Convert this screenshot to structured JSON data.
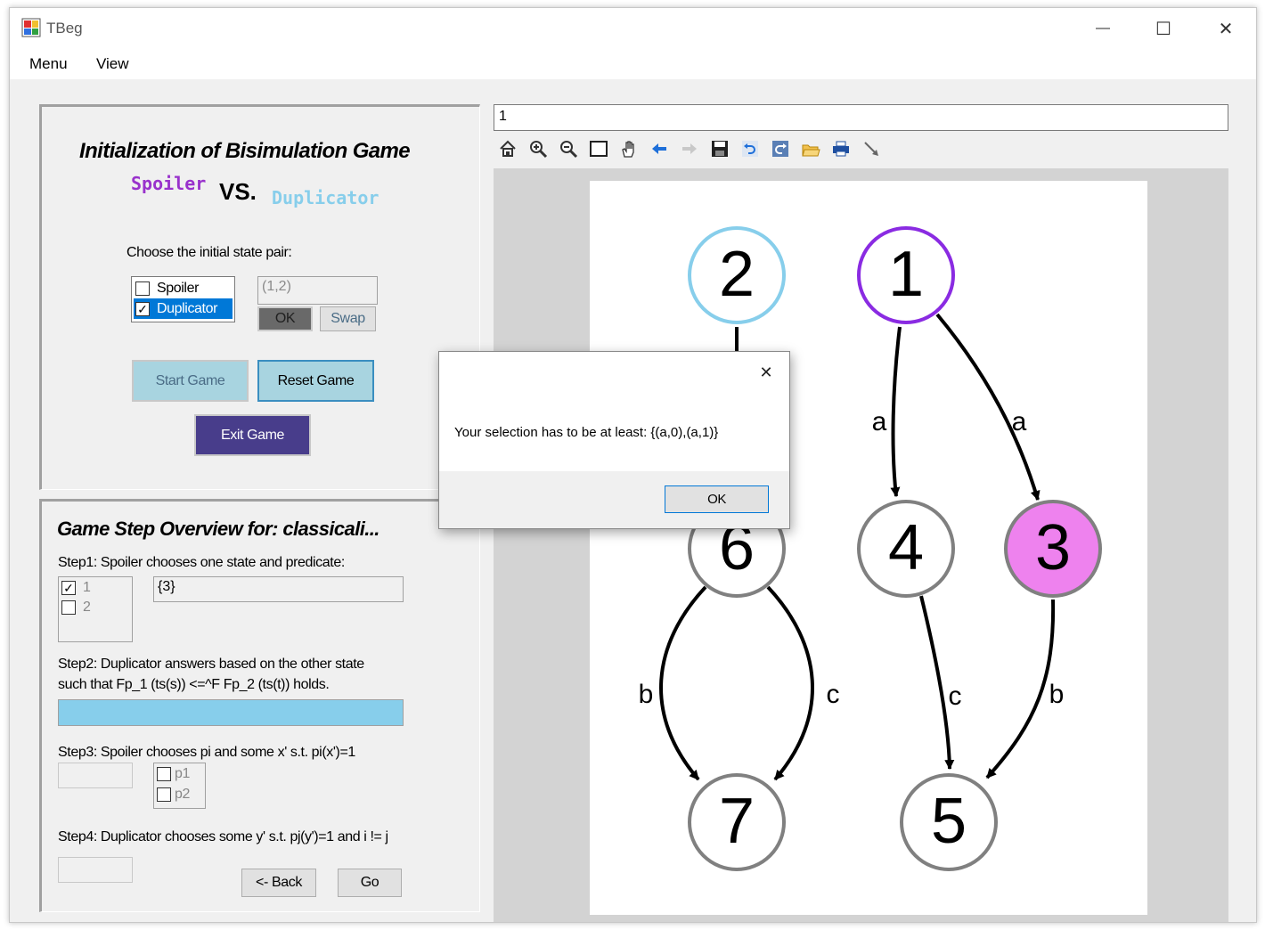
{
  "window": {
    "title": "TBeg",
    "minimize": "—",
    "maximize": "☐",
    "close": "✕"
  },
  "menu": {
    "items": [
      "Menu",
      "View"
    ]
  },
  "init_panel": {
    "title": "Initialization of Bisimulation Game",
    "spoiler": "Spoiler",
    "vs": "VS.",
    "duplicator": "Duplicator",
    "choose_label": "Choose the initial state pair:",
    "roles": [
      {
        "label": "Spoiler",
        "checked": false
      },
      {
        "label": "Duplicator",
        "checked": true
      }
    ],
    "pair_value": "(1,2)",
    "ok_label": "OK",
    "swap_label": "Swap",
    "start_label": "Start Game",
    "reset_label": "Reset Game",
    "exit_label": "Exit Game"
  },
  "steps_panel": {
    "title": "Game Step Overview for: classicali...",
    "step1": "Step1: Spoiler chooses one state and predicate:",
    "step1_states": [
      {
        "label": "1",
        "checked": true
      },
      {
        "label": "2",
        "checked": false
      }
    ],
    "step1_value": "{3}",
    "step2_line1": "Step2: Duplicator answers based on the other state",
    "step2_line2": "such that Fp_1 (ts(s)) <=^F Fp_2 (ts(t))  holds.",
    "step3": "Step3: Spoiler chooses pi and some x' s.t. pi(x')=1",
    "step3_options": [
      {
        "label": "p1",
        "checked": false
      },
      {
        "label": "p2",
        "checked": false
      }
    ],
    "step4": "Step4: Duplicator chooses some y' s.t. pj(y')=1 and i != j",
    "back_label": "<- Back",
    "go_label": "Go"
  },
  "viewer": {
    "text_value": "1",
    "toolbar_icons": [
      "home-icon",
      "zoom-in-icon",
      "zoom-out-icon",
      "select-rect-icon",
      "hand-icon",
      "back-arrow-icon",
      "forward-arrow-icon",
      "save-icon",
      "undo-icon",
      "redo-icon",
      "open-folder-icon",
      "print-icon",
      "pointer-icon"
    ]
  },
  "graph": {
    "nodes": [
      {
        "id": "2",
        "label": "2",
        "stroke": "#87ceeb",
        "fill": "#ffffff"
      },
      {
        "id": "1",
        "label": "1",
        "stroke": "#8a2be2",
        "fill": "#ffffff"
      },
      {
        "id": "6",
        "label": "6",
        "stroke": "#808080",
        "fill": "#ffffff"
      },
      {
        "id": "4",
        "label": "4",
        "stroke": "#808080",
        "fill": "#ffffff"
      },
      {
        "id": "3",
        "label": "3",
        "stroke": "#808080",
        "fill": "#ee82ee"
      },
      {
        "id": "7",
        "label": "7",
        "stroke": "#808080",
        "fill": "#ffffff"
      },
      {
        "id": "5",
        "label": "5",
        "stroke": "#808080",
        "fill": "#ffffff"
      }
    ],
    "edges": [
      {
        "from": "2",
        "to": "6",
        "label": ""
      },
      {
        "from": "1",
        "to": "4",
        "label": "a"
      },
      {
        "from": "1",
        "to": "3",
        "label": "a"
      },
      {
        "from": "6",
        "to": "7",
        "label": "b"
      },
      {
        "from": "6",
        "to": "7",
        "label": "c"
      },
      {
        "from": "4",
        "to": "5",
        "label": "c"
      },
      {
        "from": "3",
        "to": "5",
        "label": "b"
      }
    ]
  },
  "dialog": {
    "close": "✕",
    "message": "Your selection has to be at least: {(a,0),(a,1)}",
    "ok_label": "OK"
  },
  "colors": {
    "spoiler": "#9932cc",
    "duplicator": "#87ceeb",
    "exit_button": "#483d8b",
    "progress": "#87ceeb",
    "selection": "#0078d7"
  }
}
